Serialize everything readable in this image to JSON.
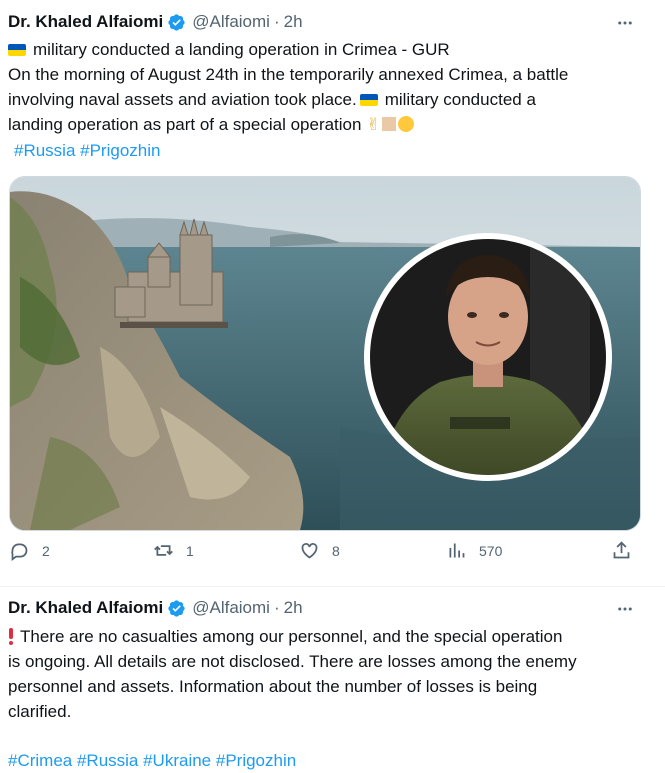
{
  "tweets": [
    {
      "author_name": "Dr. Khaled Alfaiomi",
      "handle": "@Alfaiomi",
      "separator": "·",
      "time": "2h",
      "lines": [
        "military conducted a landing operation in Crimea - GUR",
        "On the morning of August 24th in the temporarily annexed Crimea, a battle",
        "involving naval assets and aviation took place.",
        "military conducted a",
        "landing operation as part of a special operation"
      ],
      "hashtags": "#Russia #Prigozhin",
      "image_alt": "Swallow's Nest castle on a cliff with inset portrait",
      "actions": {
        "replies": "2",
        "reposts": "1",
        "likes": "8",
        "views": "570"
      }
    },
    {
      "author_name": "Dr. Khaled Alfaiomi",
      "handle": "@Alfaiomi",
      "separator": "·",
      "time": "2h",
      "lines": [
        "There are no casualties among our personnel, and the special operation",
        "is ongoing. All details are not disclosed. There are losses among the enemy",
        "personnel and assets. Information about the number of losses is being",
        "clarified."
      ],
      "hashtags": "#Crimea #Russia #Ukraine #Prigozhin"
    }
  ],
  "colors": {
    "accent": "#1d9bf0",
    "muted": "#536471",
    "alert": "#dd2e44"
  },
  "icons": {
    "verified": "verified-badge-icon",
    "more": "more-dots-icon",
    "reply": "reply-bubble-icon",
    "repost": "repost-arrows-icon",
    "like": "heart-icon",
    "views": "bar-chart-icon",
    "share": "share-upload-icon",
    "flag": "ukraine-flag-icon",
    "alert": "exclamation-icon"
  }
}
